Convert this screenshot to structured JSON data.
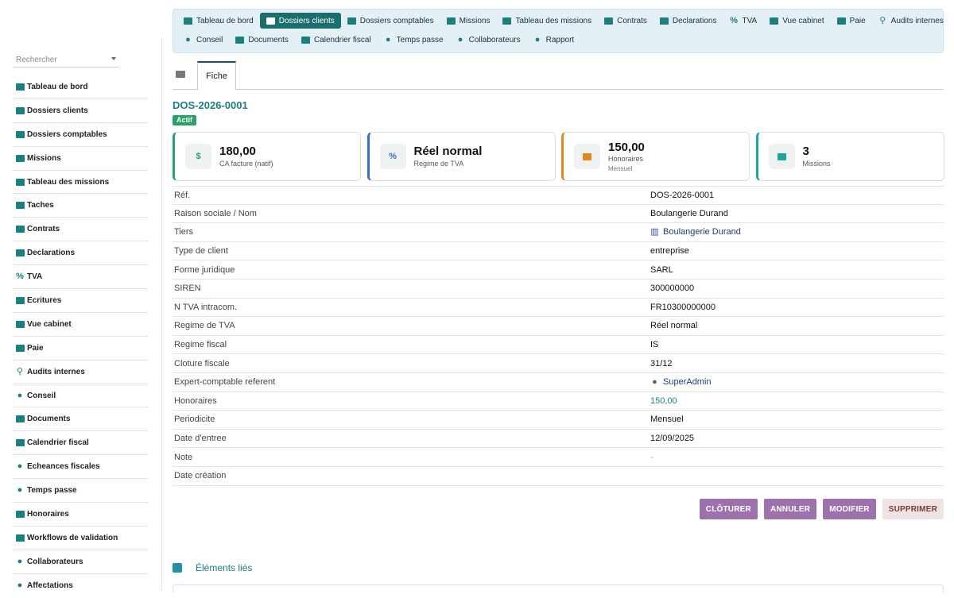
{
  "sidebar": {
    "search_placeholder": "Rechercher",
    "items": [
      {
        "label": "Tableau de bord",
        "icon": "dashboard-icon"
      },
      {
        "label": "Dossiers clients",
        "icon": "folder-open-icon"
      },
      {
        "label": "Dossiers comptables",
        "icon": "book-icon"
      },
      {
        "label": "Missions",
        "icon": "briefcase-icon"
      },
      {
        "label": "Tableau des missions",
        "icon": "table-icon"
      },
      {
        "label": "Taches",
        "icon": "tasks-icon"
      },
      {
        "label": "Contrats",
        "icon": "contract-icon"
      },
      {
        "label": "Declarations",
        "icon": "document-icon"
      },
      {
        "label": "TVA",
        "icon": "percent-icon"
      },
      {
        "label": "Ecritures",
        "icon": "ledger-icon"
      },
      {
        "label": "Vue cabinet",
        "icon": "balance-icon"
      },
      {
        "label": "Paie",
        "icon": "money-icon"
      },
      {
        "label": "Audits internes",
        "icon": "search-icon"
      },
      {
        "label": "Conseil",
        "icon": "lightbulb-icon"
      },
      {
        "label": "Documents",
        "icon": "folder-icon"
      },
      {
        "label": "Calendrier fiscal",
        "icon": "calendar-icon"
      },
      {
        "label": "Echeances fiscales",
        "icon": "clock-icon"
      },
      {
        "label": "Temps passe",
        "icon": "stopwatch-icon"
      },
      {
        "label": "Honoraires",
        "icon": "coins-icon"
      },
      {
        "label": "Workflows de validation",
        "icon": "workflow-icon"
      },
      {
        "label": "Collaborateurs",
        "icon": "users-icon"
      },
      {
        "label": "Affectations",
        "icon": "user-icon"
      }
    ]
  },
  "topnav": {
    "row1": [
      {
        "label": "Tableau de bord",
        "icon": "dashboard-icon",
        "active": false
      },
      {
        "label": "Dossiers clients",
        "icon": "folder-open-icon",
        "active": true
      },
      {
        "label": "Dossiers comptables",
        "icon": "book-icon",
        "active": false
      },
      {
        "label": "Missions",
        "icon": "briefcase-icon",
        "active": false
      },
      {
        "label": "Tableau des missions",
        "icon": "table-icon",
        "active": false
      },
      {
        "label": "Contrats",
        "icon": "contract-icon",
        "active": false
      },
      {
        "label": "Declarations",
        "icon": "document-icon",
        "active": false
      },
      {
        "label": "TVA",
        "icon": "percent-icon",
        "active": false
      },
      {
        "label": "Vue cabinet",
        "icon": "balance-icon",
        "active": false
      },
      {
        "label": "Paie",
        "icon": "money-icon",
        "active": false
      },
      {
        "label": "Audits internes",
        "icon": "search-icon",
        "active": false
      }
    ],
    "row2": [
      {
        "label": "Conseil",
        "icon": "lightbulb-icon",
        "active": false
      },
      {
        "label": "Documents",
        "icon": "folder-icon",
        "active": false
      },
      {
        "label": "Calendrier fiscal",
        "icon": "calendar-icon",
        "active": false
      },
      {
        "label": "Temps passe",
        "icon": "stopwatch-icon",
        "active": false
      },
      {
        "label": "Collaborateurs",
        "icon": "users-icon",
        "active": false
      },
      {
        "label": "Rapport",
        "icon": "pie-chart-icon",
        "active": false
      }
    ]
  },
  "tabs": {
    "fiche": "Fiche"
  },
  "record": {
    "ref": "DOS-2026-0001",
    "status": "Actif"
  },
  "cards": [
    {
      "value": "180,00",
      "label": "CA facture (natif)",
      "sub": "",
      "icon": "invoice-dollar-icon",
      "accent": "#2aa167"
    },
    {
      "value": "Réel normal",
      "label": "Regime de TVA",
      "sub": "",
      "icon": "percent-icon",
      "accent": "#2f6fd6"
    },
    {
      "value": "150,00",
      "label": "Honoraires",
      "sub": "Mensuel",
      "icon": "coins-icon",
      "accent": "#e08a1e"
    },
    {
      "value": "3",
      "label": "Missions",
      "sub": "",
      "icon": "briefcase-icon",
      "accent": "#1ba89a"
    }
  ],
  "details": [
    {
      "label": "Réf.",
      "value": "DOS-2026-0001",
      "style": ""
    },
    {
      "label": "Raison sociale / Nom",
      "value": "Boulangerie Durand",
      "style": ""
    },
    {
      "label": "Tiers",
      "value": "Boulangerie Durand",
      "style": "link",
      "icon": "building-icon"
    },
    {
      "label": "Type de client",
      "value": "entreprise",
      "style": ""
    },
    {
      "label": "Forme juridique",
      "value": "SARL",
      "style": ""
    },
    {
      "label": "SIREN",
      "value": "300000000",
      "style": ""
    },
    {
      "label": "N TVA intracom.",
      "value": "FR10300000000",
      "style": ""
    },
    {
      "label": "Regime de TVA",
      "value": "Réel normal",
      "style": ""
    },
    {
      "label": "Regime fiscal",
      "value": "IS",
      "style": ""
    },
    {
      "label": "Cloture fiscale",
      "value": "31/12",
      "style": ""
    },
    {
      "label": "Expert-comptable referent",
      "value": "SuperAdmin",
      "style": "link",
      "icon": "user-icon"
    },
    {
      "label": "Honoraires",
      "value": "150,00",
      "style": "teal"
    },
    {
      "label": "Periodicite",
      "value": "Mensuel",
      "style": ""
    },
    {
      "label": "Date d'entree",
      "value": "12/09/2025",
      "style": ""
    },
    {
      "label": "Note",
      "value": "-",
      "style": "muted"
    },
    {
      "label": "Date création",
      "value": "",
      "style": ""
    }
  ],
  "actions": {
    "close": "CLÔTURER",
    "cancel": "ANNULER",
    "edit": "MODIFIER",
    "delete": "SUPPRIMER"
  },
  "linked": {
    "title": "Éléments liés"
  },
  "colors": {
    "accent": "#1b7f7d",
    "active_tab": "#1b6e6d",
    "button": "#9d72ac"
  }
}
